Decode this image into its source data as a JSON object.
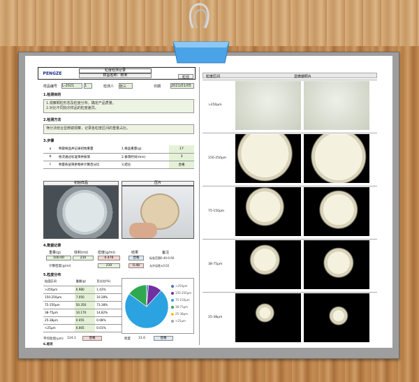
{
  "header": {
    "logo_text": "PENGZE",
    "title": "粒度检测记录",
    "subtitle": "样品名称：粉末",
    "box_right": "粒径"
  },
  "meta": {
    "sample_label": "样品编号",
    "sample_value": "L-2021",
    "qty_label": "数量",
    "qty_value": "1",
    "operator_label": "检测人",
    "operator_value": "张三",
    "date_label": "日期",
    "date_value": "2021/01/05"
  },
  "sections": {
    "s1": "1.检测目的",
    "s2": "2.检测方法",
    "s3": "3.步骤",
    "s4": "4.数据记录",
    "s5": "5.粒度分布",
    "s6": "6.结论"
  },
  "notes": {
    "purpose_1": "1.观察颗粒形态及粒度分布，确定产品质量。",
    "purpose_2": "2.对比不同批次样品的粒度差异。",
    "method": "筛分法结合显微镜观察，记录各粒度区间的重量占比。"
  },
  "steps": [
    {
      "no": "a",
      "text": "称取样品并记录初始重量",
      "param": "1.样品重量(g)",
      "val": "17"
    },
    {
      "no": "b",
      "text": "依次通过标准筛并振荡",
      "param": "2.振荡时间(min)",
      "val": "3"
    },
    {
      "no": "c",
      "text": "称量各层筛余物并计算百分比",
      "param": "3.结论",
      "val": "合格"
    }
  ],
  "photos": {
    "left": "初始样品",
    "right": "压片"
  },
  "data_table": {
    "head": [
      "重量(g)",
      "体积(ml)",
      "密度(g/ml)",
      "结果",
      "备注"
    ],
    "row1": [
      "100.00",
      "210",
      "0.476",
      "合格"
    ],
    "row2_label": "计算密度(g/ml)",
    "row2": [
      "210",
      "0.48"
    ],
    "note1": "标准范围0.40-0.60",
    "note2": "允许误差±0.02"
  },
  "distribution": {
    "head": [
      "粒度区间",
      "重量(g)",
      "百分比(%)"
    ],
    "rows": [
      {
        "range": ">250μm",
        "weight": "0.980",
        "pct": "1.43%"
      },
      {
        "range": "150-250μm",
        "weight": "7.050",
        "pct": "10.28%"
      },
      {
        "range": "75-150μm",
        "weight": "50.350",
        "pct": "73.38%"
      },
      {
        "range": "38-75μm",
        "weight": "10.170",
        "pct": "14.82%"
      },
      {
        "range": "25-38μm",
        "weight": "0.055",
        "pct": "0.08%"
      },
      {
        "range": "<25μm",
        "weight": "0.005",
        "pct": "0.01%"
      }
    ],
    "total_label": "平均粒径(μm)",
    "total_value": "124.1",
    "result_label": "结论",
    "result_value": "合格",
    "span_label": "跨度",
    "span_value": "31.6"
  },
  "pie": {
    "slices": [
      {
        "label": ">250μm",
        "pct": 1.43,
        "color": "#4472c4"
      },
      {
        "label": "150-250μm",
        "pct": 10.28,
        "color": "#7030a0"
      },
      {
        "label": "75-150μm",
        "pct": 73.38,
        "color": "#2ba3e0"
      },
      {
        "label": "38-75μm",
        "pct": 14.82,
        "color": "#2fa84f"
      },
      {
        "label": "25-38μm",
        "pct": 0.08,
        "color": "#ffc000"
      },
      {
        "label": "<25μm",
        "pct": 0.01,
        "color": "#a5a5a5"
      }
    ]
  },
  "micro": {
    "header_left": "粒度区间",
    "header_right": "显微镜照片",
    "rows": [
      ">250μm",
      "150-250μm",
      "75-150μm",
      "38-75μm",
      "25-38μm"
    ]
  }
}
